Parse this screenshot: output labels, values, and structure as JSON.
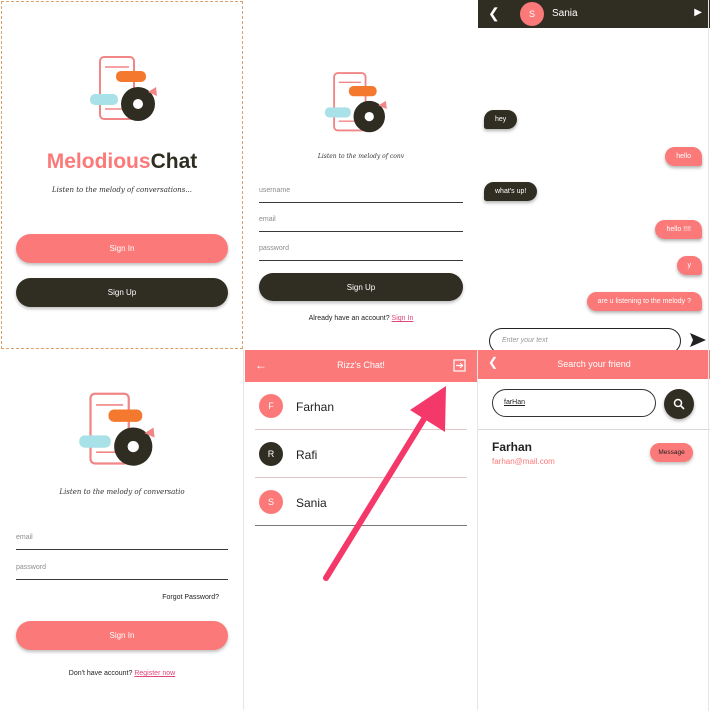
{
  "welcome": {
    "brand_part1": "Melodious",
    "brand_part2": "Chat",
    "tagline": "Listen to the melody of conversations...",
    "signin_label": "Sign In",
    "signup_label": "Sign Up"
  },
  "signup": {
    "tagline": "Listen to the melody of conv",
    "username_placeholder": "username",
    "email_placeholder": "email",
    "password_placeholder": "password",
    "signup_label": "Sign Up",
    "already_text": "Already have an account?",
    "signin_link": "Sign In"
  },
  "chat": {
    "contact_initial": "S",
    "contact_name": "Sania",
    "messages": [
      {
        "text": "hey",
        "dir": "in"
      },
      {
        "text": "hello",
        "dir": "out"
      },
      {
        "text": "what's up!",
        "dir": "in"
      },
      {
        "text": "hello !!!!",
        "dir": "out"
      },
      {
        "text": "y",
        "dir": "out"
      },
      {
        "text": "are u listening to the melody ?",
        "dir": "out"
      }
    ],
    "input_placeholder": "Enter your text"
  },
  "login": {
    "tagline": "Listen to the melody of conversatio",
    "email_placeholder": "email",
    "password_placeholder": "password",
    "forgot_label": "Forgot Password?",
    "signin_label": "Sign In",
    "no_account_text": "Don't have account?",
    "register_link": "Register now"
  },
  "contacts": {
    "title": "Rizz's Chat!",
    "items": [
      {
        "initial": "F",
        "name": "Farhan",
        "avatar_color": "#fb7a79"
      },
      {
        "initial": "R",
        "name": "Rafi",
        "avatar_color": "#302e23"
      },
      {
        "initial": "S",
        "name": "Sania",
        "avatar_color": "#fb7a79"
      }
    ]
  },
  "search": {
    "title": "Search your friend",
    "query": "farHan",
    "result_name": "Farhan",
    "result_email": "farhan@mail.com",
    "message_label": "Message"
  },
  "colors": {
    "accent": "#fb7a79",
    "dark": "#302e23",
    "arrow": "#f5386a"
  }
}
